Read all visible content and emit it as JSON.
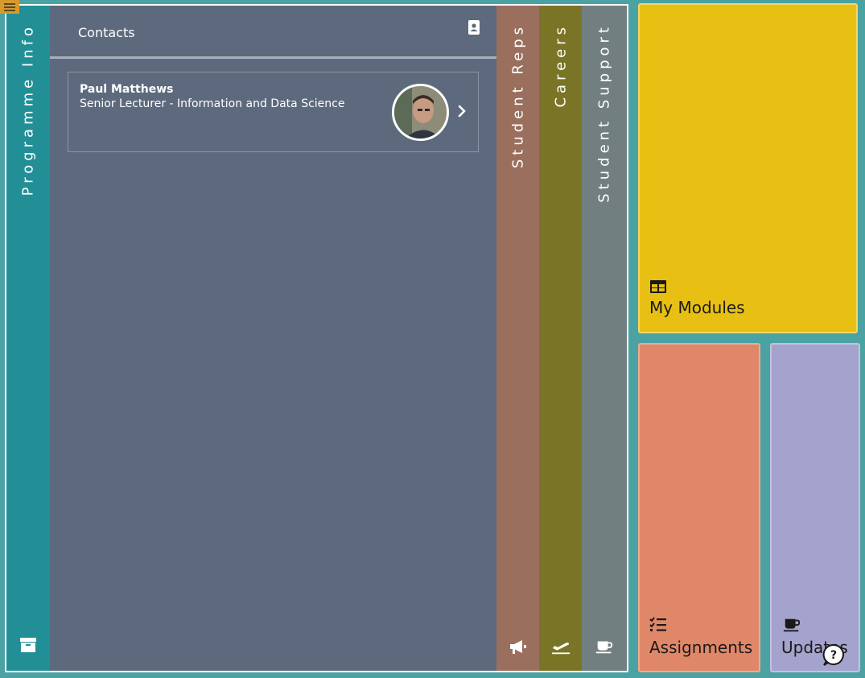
{
  "tabs": {
    "programme": "Programme Info",
    "reps": "Student Reps",
    "careers": "Careers",
    "support": "Student Support"
  },
  "panel": {
    "title": "Contacts",
    "contacts": [
      {
        "name": "Paul Matthews",
        "role": "Senior Lecturer - Information and Data Science"
      }
    ]
  },
  "tiles": {
    "modules": "My Modules",
    "assignments": "Assignments",
    "updates": "Updates"
  },
  "icons": {
    "menu": "hamburger-icon",
    "programme": "archive-icon",
    "contacts": "address-book-icon",
    "reps": "megaphone-icon",
    "careers": "plane-icon",
    "support": "coffee-icon",
    "modules": "table-icon",
    "assignments": "checklist-icon",
    "updates": "coffee-icon",
    "help": "help-icon"
  },
  "colors": {
    "background": "#4aa3a2",
    "programme": "#228f96",
    "panel": "#5d6a7d",
    "reps": "#9b6f5e",
    "careers": "#7a7526",
    "support": "#717f80",
    "modules": "#e8c014",
    "assignments": "#e08769",
    "updates": "#a3a3cd"
  }
}
